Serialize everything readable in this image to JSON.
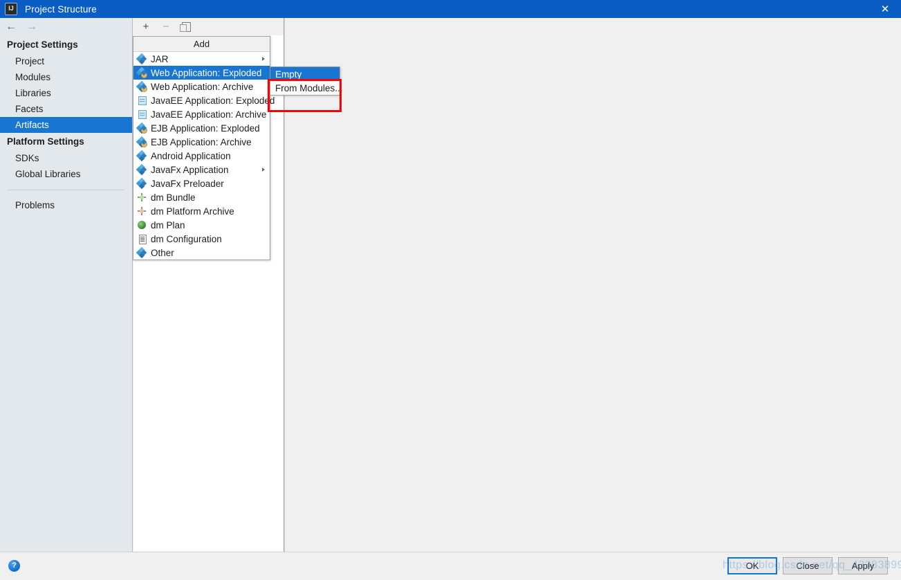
{
  "window": {
    "title": "Project Structure",
    "app_icon": "intellij-idea-icon",
    "close_icon": "✕",
    "titlebar_color": "#0a5dc2"
  },
  "nav": {
    "back_icon": "←",
    "forward_icon": "→"
  },
  "sidebar": {
    "groups": [
      {
        "label": "Project Settings",
        "items": [
          {
            "label": "Project",
            "selected": false
          },
          {
            "label": "Modules",
            "selected": false
          },
          {
            "label": "Libraries",
            "selected": false
          },
          {
            "label": "Facets",
            "selected": false
          },
          {
            "label": "Artifacts",
            "selected": true
          }
        ]
      },
      {
        "label": "Platform Settings",
        "items": [
          {
            "label": "SDKs",
            "selected": false
          },
          {
            "label": "Global Libraries",
            "selected": false
          }
        ]
      }
    ],
    "footer_items": [
      {
        "label": "Problems",
        "selected": false
      }
    ],
    "selected_color": "#1876d2"
  },
  "toolbar": {
    "add_icon": "+",
    "remove_icon": "−",
    "copy_icon": "copy-icon"
  },
  "add_menu": {
    "title": "Add",
    "items": [
      {
        "label": "JAR",
        "icon": "diamond-icon",
        "has_submenu": true,
        "selected": false
      },
      {
        "label": "Web Application: Exploded",
        "icon": "web-exploded-icon",
        "has_submenu": true,
        "selected": true
      },
      {
        "label": "Web Application: Archive",
        "icon": "web-archive-icon",
        "has_submenu": false,
        "selected": false
      },
      {
        "label": "JavaEE Application: Exploded",
        "icon": "javaee-exploded-icon",
        "has_submenu": false,
        "selected": false
      },
      {
        "label": "JavaEE Application: Archive",
        "icon": "javaee-archive-icon",
        "has_submenu": false,
        "selected": false
      },
      {
        "label": "EJB Application: Exploded",
        "icon": "ejb-exploded-icon",
        "has_submenu": false,
        "selected": false
      },
      {
        "label": "EJB Application: Archive",
        "icon": "ejb-archive-icon",
        "has_submenu": false,
        "selected": false
      },
      {
        "label": "Android Application",
        "icon": "android-icon",
        "has_submenu": false,
        "selected": false
      },
      {
        "label": "JavaFx Application",
        "icon": "javafx-icon",
        "has_submenu": true,
        "selected": false
      },
      {
        "label": "JavaFx Preloader",
        "icon": "javafx-preloader-icon",
        "has_submenu": false,
        "selected": false
      },
      {
        "label": "dm Bundle",
        "icon": "dm-bundle-icon",
        "has_submenu": false,
        "selected": false
      },
      {
        "label": "dm Platform Archive",
        "icon": "dm-platform-archive-icon",
        "has_submenu": false,
        "selected": false
      },
      {
        "label": "dm Plan",
        "icon": "dm-plan-icon",
        "has_submenu": false,
        "selected": false
      },
      {
        "label": "dm Configuration",
        "icon": "dm-configuration-icon",
        "has_submenu": false,
        "selected": false
      },
      {
        "label": "Other",
        "icon": "other-icon",
        "has_submenu": false,
        "selected": false
      }
    ]
  },
  "submenu": {
    "items": [
      {
        "label": "Empty",
        "selected": true
      },
      {
        "label": "From Modules...",
        "selected": false
      }
    ],
    "annotation_color": "#ff0000"
  },
  "footer": {
    "help_icon": "?",
    "buttons": [
      {
        "label": "OK",
        "default": true
      },
      {
        "label": "Close",
        "default": false
      },
      {
        "label": "Apply",
        "default": false
      }
    ]
  },
  "watermark": {
    "text": "https://blog.csdn.net/qq_43383899"
  }
}
